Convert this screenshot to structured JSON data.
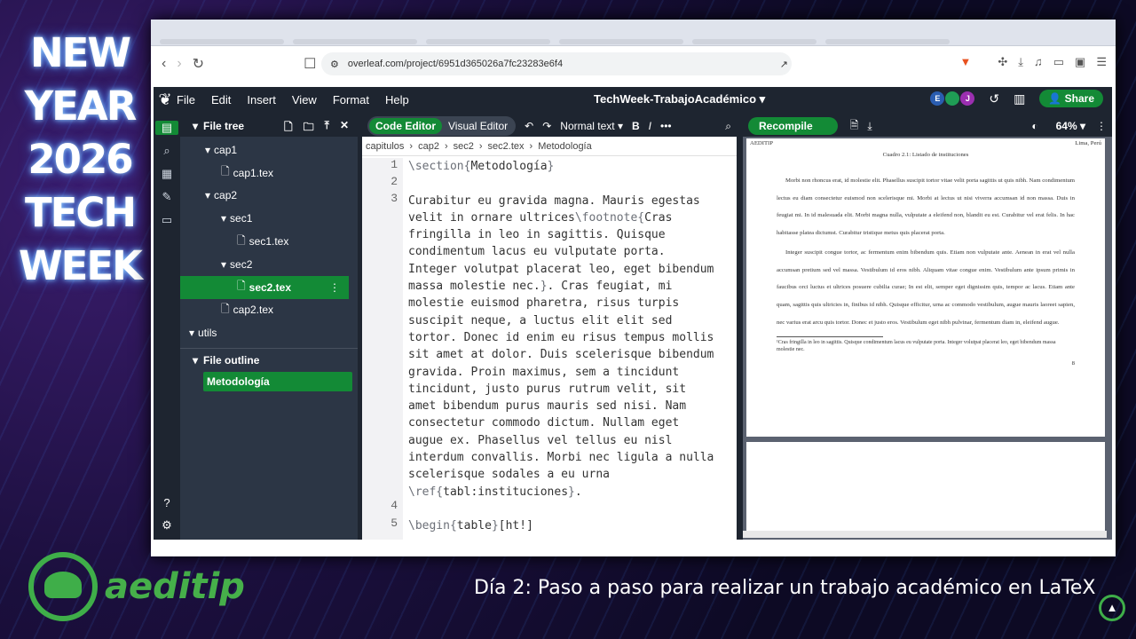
{
  "banner": [
    "NEW",
    "YEAR",
    "2026",
    "TECH",
    "WEEK"
  ],
  "logo_text": "aeditip",
  "subtitle": "Día 2: Paso a paso para realizar un trabajo académico en LaTeX",
  "browser": {
    "url": "overleaf.com/project/6951d365026a7fc23283e6f4"
  },
  "menu": [
    "File",
    "Edit",
    "Insert",
    "View",
    "Format",
    "Help"
  ],
  "project_title": "TechWeek-TrabajoAcadémico",
  "share_label": "Share",
  "avatars": [
    {
      "l": "E",
      "c": "#2a5db0"
    },
    {
      "l": "",
      "c": "#1f9d55"
    },
    {
      "l": "J",
      "c": "#9b2fb0"
    }
  ],
  "file_tree": {
    "title": "File tree",
    "items": [
      {
        "label": "cap1",
        "type": "folder",
        "depth": 1
      },
      {
        "label": "cap1.tex",
        "type": "file",
        "depth": 2
      },
      {
        "label": "cap2",
        "type": "folder",
        "depth": 1
      },
      {
        "label": "sec1",
        "type": "folder",
        "depth": 2
      },
      {
        "label": "sec1.tex",
        "type": "file",
        "depth": 3
      },
      {
        "label": "sec2",
        "type": "folder",
        "depth": 2
      },
      {
        "label": "sec2.tex",
        "type": "file",
        "depth": 3,
        "selected": true
      },
      {
        "label": "cap2.tex",
        "type": "file",
        "depth": 2
      },
      {
        "label": "utils",
        "type": "folder",
        "depth": 0
      }
    ]
  },
  "outline": {
    "title": "File outline",
    "item": "Metodología"
  },
  "editor": {
    "code_editor": "Code Editor",
    "visual_editor": "Visual Editor",
    "style": "Normal text",
    "crumbs": [
      "capitulos",
      "cap2",
      "sec2",
      "sec2.tex",
      "Metodología"
    ],
    "line_numbers": [
      "1",
      "2",
      "3",
      "4",
      "5"
    ]
  },
  "pdf": {
    "recompile": "Recompile",
    "zoom": "64%",
    "header_left": "AEDITIP",
    "header_right": "Lima, Perú",
    "caption": "Cuadro 2.1: Listado de instituciones",
    "p1": "Morbi non rhoncus erat, id molestie elit. Phasellus suscipit tortor vitae velit porta sagittis ut quis nibh. Nam condimentum lectus eu diam consectetur euismod non scelerisque mi. Morbi at lectus ut nisi viverra accumsan id non massa. Duis in feugiat mi. In id malesuada elit. Morbi magna nulla, vulputate a eleifend non, blandit eu est. Curabitur vel erat felis. In hac habitasse platea dictumst. Curabitur tristique metus quis placerat porta.",
    "p2": "Integer suscipit congue tortor, ac fermentum enim bibendum quis. Etiam non vulputate ante. Aenean in erat vel nulla accumsan pretium sed vel massa. Vestibulum id eros nibh. Aliquam vitae congue enim. Vestibulum ante ipsum primis in faucibus orci luctus et ultrices posuere cubilia curae; In est elit, semper eget dignissim quis, tempor ac lacus. Etiam ante quam, sagittis quis ultricies in, finibus id nibh. Quisque efficitur, urna ac commodo vestibulum, augue mauris laoreet sapien, nec varius erat arcu quis tortor. Donec et justo eros. Vestibulum eget nibh pulvinar, fermentum diam in, eleifend augue.",
    "footnote": "¹Cras fringilla in leo in sagittis. Quisque condimentum lacus eu vulputate porta. Integer volutpat placerat leo, eget bibendum massa molestie nec.",
    "page_number": "8"
  }
}
